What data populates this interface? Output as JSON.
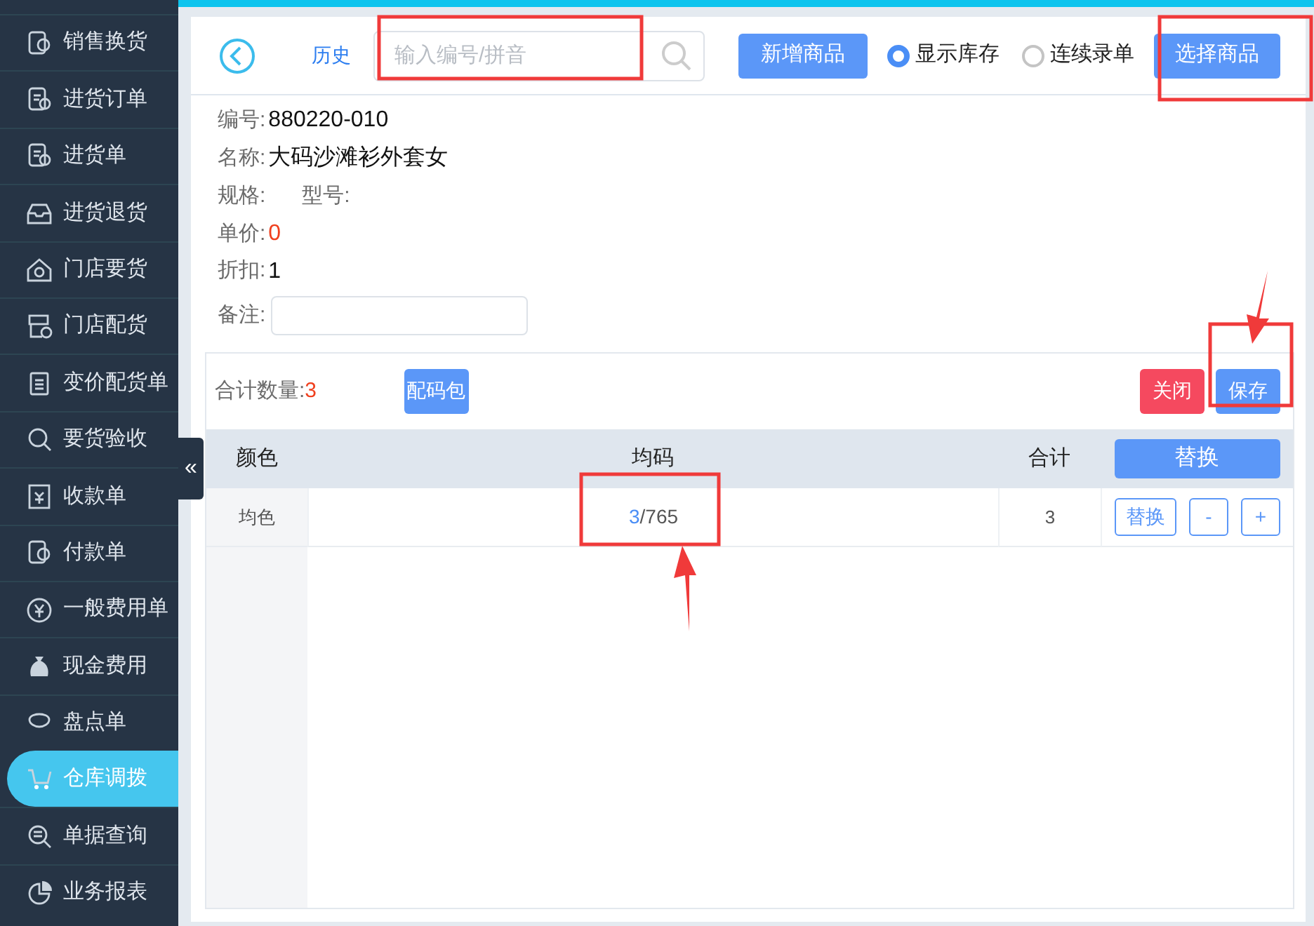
{
  "sidebar": {
    "items": [
      {
        "label": "销售换货",
        "selected": false
      },
      {
        "label": "进货订单",
        "selected": false
      },
      {
        "label": "进货单",
        "selected": false
      },
      {
        "label": "进货退货",
        "selected": false
      },
      {
        "label": "门店要货",
        "selected": false
      },
      {
        "label": "门店配货",
        "selected": false
      },
      {
        "label": "变价配货单",
        "selected": false
      },
      {
        "label": "要货验收",
        "selected": false
      },
      {
        "label": "收款单",
        "selected": false
      },
      {
        "label": "付款单",
        "selected": false
      },
      {
        "label": "一般费用单",
        "selected": false
      },
      {
        "label": "现金费用",
        "selected": false
      },
      {
        "label": "盘点单",
        "selected": false
      },
      {
        "label": "仓库调拨",
        "selected": true
      },
      {
        "label": "单据查询",
        "selected": false
      },
      {
        "label": "业务报表",
        "selected": false
      }
    ],
    "collapse_toggle": "«"
  },
  "toolbar": {
    "history_link": "历史",
    "search": {
      "placeholder": "输入编号/拼音"
    },
    "new_button": "新增商品",
    "options": [
      {
        "label": "显示库存",
        "checked": true
      },
      {
        "label": "连续录单",
        "checked": false
      }
    ],
    "select_button": "选择商品"
  },
  "details": {
    "code_label": "编号:",
    "code": "880220-010",
    "name_label": "名称:",
    "name": "大码沙滩衫外套女",
    "spec_label": "规格:",
    "model_label": "型号:",
    "price_label": "单价:",
    "price": "0",
    "discount_label": "折扣:",
    "discount": "1",
    "note_label": "备注:"
  },
  "summary": {
    "total_label": "合计数量:",
    "total": "3",
    "pack_button": "配码包",
    "close_button": "关闭",
    "save_button": "保存"
  },
  "table": {
    "columns": [
      "颜色",
      "均码",
      "合计"
    ],
    "header_button": "替换",
    "rows": [
      {
        "color_name": "均色",
        "entered": "3",
        "rest": "/765",
        "total": "3",
        "replace": "替换",
        "minus": "-",
        "plus": "+"
      }
    ]
  }
}
